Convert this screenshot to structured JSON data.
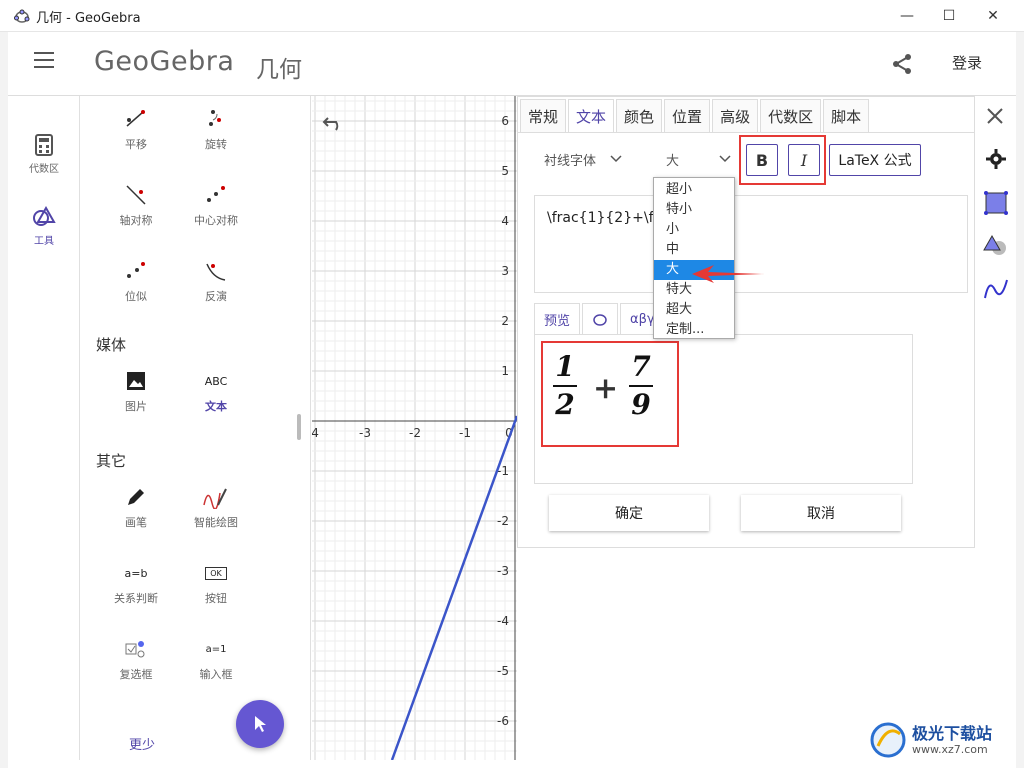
{
  "window": {
    "title": "几何 - GeoGebra",
    "minimize": "—",
    "maximize": "☐",
    "close": "✕"
  },
  "header": {
    "logo": "GeoGebra",
    "app_name": "几何",
    "login": "登录"
  },
  "rail": {
    "algebra": "代数区",
    "tools": "工具"
  },
  "tools": {
    "row1": [
      "平移",
      "旋转"
    ],
    "row2": [
      "轴对称",
      "中心对称"
    ],
    "row3": [
      "位似",
      "反演"
    ],
    "media_title": "媒体",
    "media": [
      "图片",
      "文本"
    ],
    "text_icon_label": "ABC",
    "other_title": "其它",
    "other": [
      "画笔",
      "智能绘图",
      "关系判断",
      "按钮",
      "复选框",
      "输入框"
    ],
    "button_icon_label": "OK",
    "relation_icon_label": "a=b",
    "input_icon_label": "a=1",
    "less": "更少"
  },
  "axes": {
    "y_ticks": [
      "6",
      "5",
      "4",
      "3",
      "2",
      "1",
      "-1",
      "-2",
      "-3",
      "-4",
      "-5",
      "-6"
    ],
    "x_ticks": [
      "4",
      "-3",
      "-2",
      "-1",
      "0"
    ]
  },
  "props": {
    "tabs": [
      "常规",
      "文本",
      "颜色",
      "位置",
      "高级",
      "代数区",
      "脚本"
    ],
    "active_tab": "文本",
    "font_select": "衬线字体",
    "size_select": "大",
    "bold": "B",
    "italic": "I",
    "latex": "LaTeX 公式",
    "editor_text": "\\frac{1}{2}+\\fr",
    "subtabs": [
      "预览",
      "αβγ"
    ],
    "preview": {
      "n1": "1",
      "d1": "2",
      "op": "+",
      "n2": "7",
      "d2": "9"
    },
    "ok": "确定",
    "cancel": "取消"
  },
  "size_dropdown": {
    "options": [
      "超小",
      "特小",
      "小",
      "中",
      "大",
      "特大",
      "超大",
      "定制..."
    ],
    "selected": "大"
  },
  "watermark": {
    "name": "极光下载站",
    "url": "www.xz7.com"
  },
  "colors": {
    "accent": "#5145a8",
    "fab": "#6557d2",
    "highlight": "#e53935",
    "line": "#3b55c9",
    "selected": "#1e88e5"
  }
}
